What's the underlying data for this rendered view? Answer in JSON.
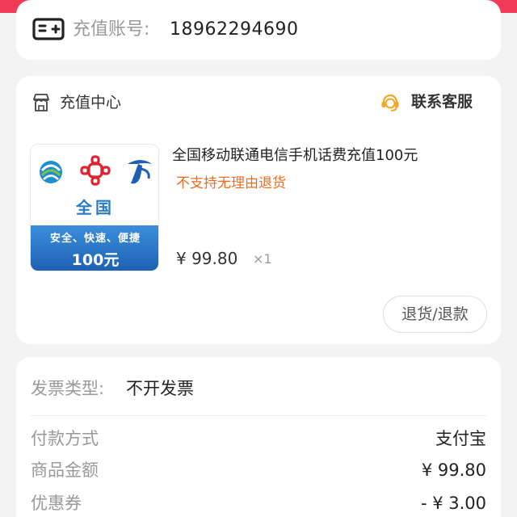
{
  "account": {
    "label": "充值账号:",
    "value": "18962294690",
    "icon": "card-icon"
  },
  "order": {
    "store_name": "充值中心",
    "store_icon": "store-icon",
    "service_label": "联系客服",
    "service_icon": "customer-service-icon",
    "service_color": "#f5a623",
    "product": {
      "title": "全国移动联通电信手机话费充值100元",
      "note": "不支持无理由退货",
      "note_color": "#f26a1b",
      "price": "¥ 99.80",
      "quantity": "×1",
      "image": {
        "region": "全国",
        "slogan": "安全、快速、便捷",
        "amount": "100元"
      }
    },
    "refund_button": "退货/退款"
  },
  "payment": {
    "invoice_label": "发票类型:",
    "invoice_value": "不开发票",
    "rows": [
      {
        "label": "付款方式",
        "value": "支付宝"
      },
      {
        "label": "商品金额",
        "value": "¥ 99.80"
      },
      {
        "label": "优惠券",
        "value": "- ¥ 3.00"
      }
    ]
  },
  "colors": {
    "brand_red": "#f03a57",
    "background": "#f3f3f3"
  }
}
